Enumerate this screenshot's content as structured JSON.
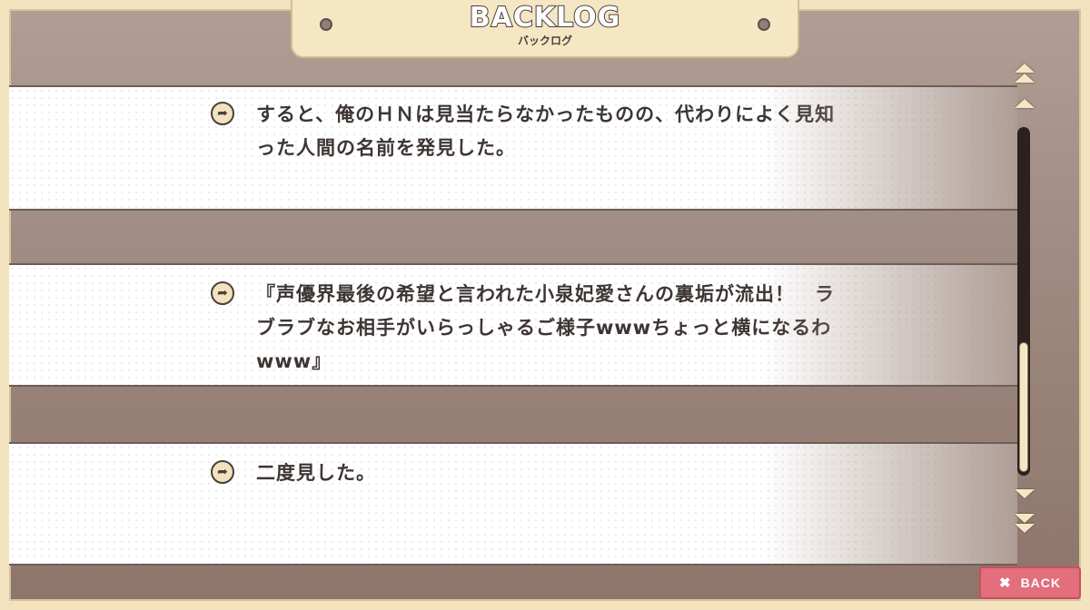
{
  "header": {
    "title": "BACKLOG",
    "subtitle": "バックログ"
  },
  "entries": [
    {
      "text": "すると、俺のＨＮは見当たらなかったものの、代わりによく見知った人間の名前を発見した。"
    },
    {
      "text": "『声優界最後の希望と言われた小泉妃愛さんの裏垢が流出！　ラブラブなお相手がいらっしゃるご様子wwwちょっと横になるわwww』"
    },
    {
      "text": "二度見した。"
    }
  ],
  "scrollbar": {
    "thumb_position": 0.62,
    "thumb_size": 0.38
  },
  "back_button": {
    "icon": "close-icon",
    "label": "BACK"
  },
  "colors": {
    "accent": "#f6e7c4",
    "back_button": "#e36f7d",
    "text": "#3d3533"
  }
}
